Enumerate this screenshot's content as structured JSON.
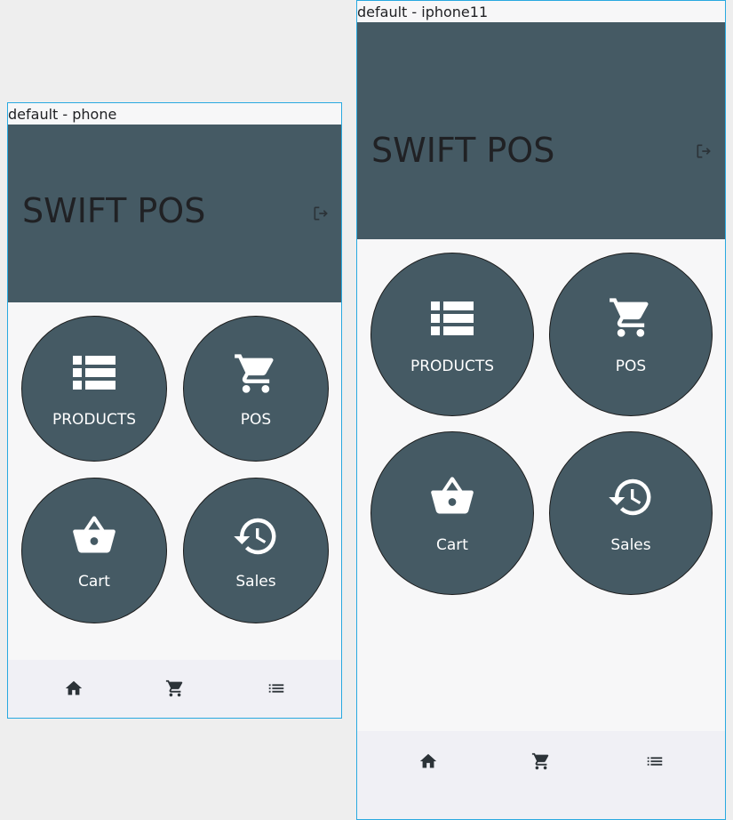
{
  "devices": [
    {
      "caption": "default - phone",
      "app_title": "SWIFT POS",
      "tiles": [
        {
          "label": "PRODUCTS",
          "icon": "list-table-icon"
        },
        {
          "label": "POS",
          "icon": "shopping-cart-icon"
        },
        {
          "label": "Cart",
          "icon": "basket-icon"
        },
        {
          "label": "Sales",
          "icon": "history-icon"
        }
      ],
      "nav": [
        "home-icon",
        "cart-icon",
        "list-icon"
      ]
    },
    {
      "caption": "default - iphone11",
      "app_title": "SWIFT POS",
      "tiles": [
        {
          "label": "PRODUCTS",
          "icon": "list-table-icon"
        },
        {
          "label": "POS",
          "icon": "shopping-cart-icon"
        },
        {
          "label": "Cart",
          "icon": "basket-icon"
        },
        {
          "label": "Sales",
          "icon": "history-icon"
        }
      ],
      "nav": [
        "home-icon",
        "cart-icon",
        "list-icon"
      ]
    }
  ],
  "colors": {
    "header": "#455a64",
    "tile": "#455a64",
    "background": "#f7f7f8",
    "nav_bar": "#f0f0f5",
    "frame_border": "#29a9e0",
    "title_text": "#202124",
    "tile_text": "#ffffff"
  }
}
